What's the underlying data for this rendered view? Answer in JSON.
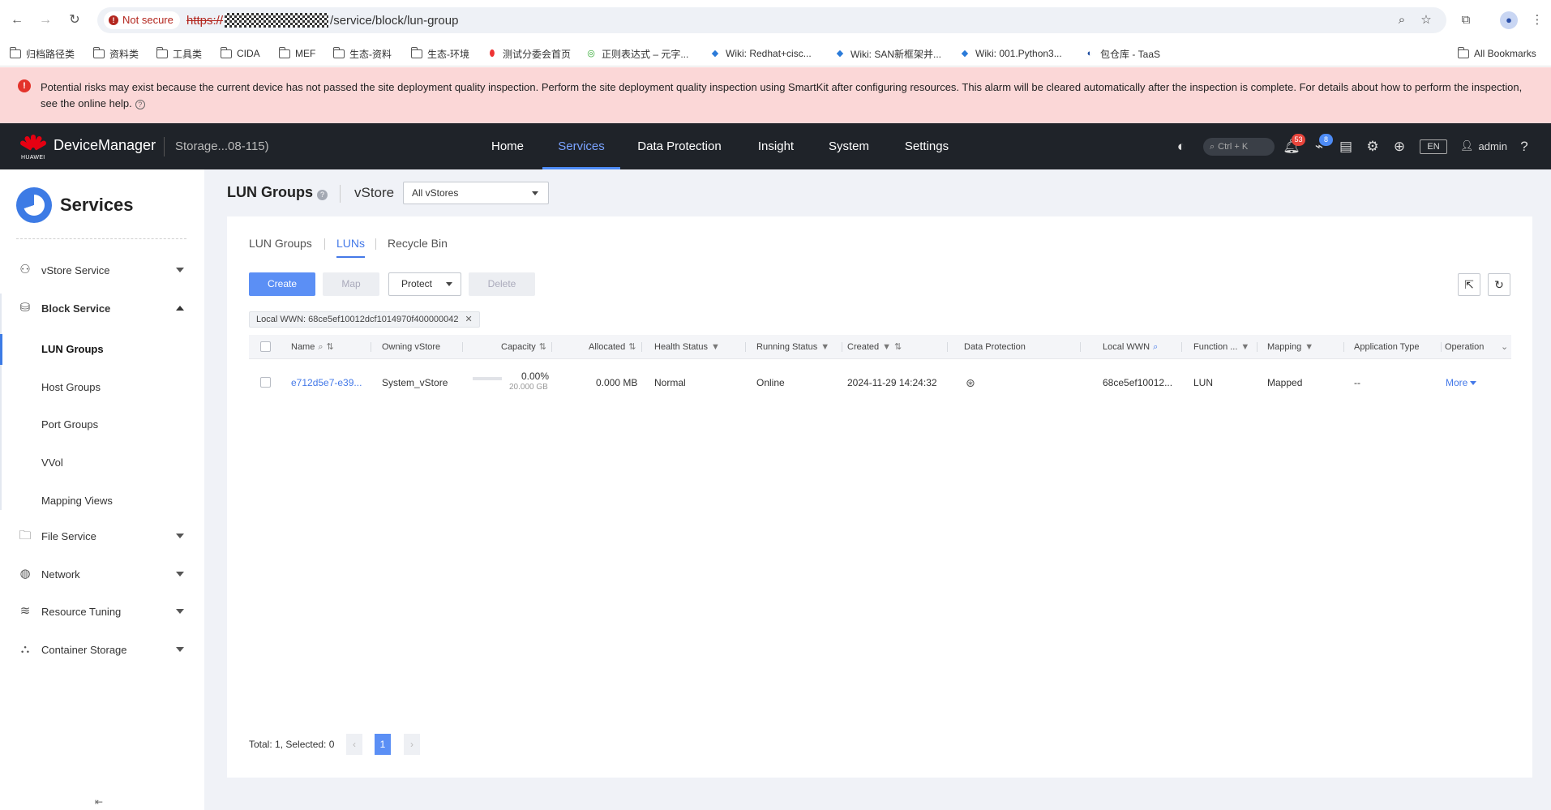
{
  "browser": {
    "not_secure": "Not secure",
    "url_scheme": "https://",
    "url_path": "/service/block/lun-group",
    "bookmarks": [
      "归档路径类",
      "资料类",
      "工具类",
      "CIDA",
      "MEF",
      "生态-资料",
      "生态-环境",
      "测试分委会首页",
      "正则表达式 – 元字...",
      "Wiki: Redhat+cisc...",
      "Wiki: SAN新框架并...",
      "Wiki: 001.Python3...",
      "包仓库 - TaaS"
    ],
    "all_bookmarks": "All Bookmarks"
  },
  "alert": {
    "text": "Potential risks may exist because the current device has not passed the site deployment quality inspection. Perform the site deployment quality inspection using SmartKit after configuring resources. This alarm will be cleared automatically after the inspection is complete. For details about how to perform the inspection, see the online help."
  },
  "header": {
    "logo_word": "HUAWEI",
    "app_name": "DeviceManager",
    "device_name": "Storage...08-115)",
    "nav": [
      "Home",
      "Services",
      "Data Protection",
      "Insight",
      "System",
      "Settings"
    ],
    "active_nav": "Services",
    "search_hint": "Ctrl + K",
    "alarm_count": "53",
    "task_count": "8",
    "language": "EN",
    "user": "admin"
  },
  "sidebar": {
    "title": "Services",
    "items": [
      {
        "label": "vStore Service",
        "icon": "user-group-icon"
      },
      {
        "label": "Block Service",
        "icon": "database-icon"
      },
      {
        "label": "File Service",
        "icon": "folder-icon"
      },
      {
        "label": "Network",
        "icon": "globe-icon"
      },
      {
        "label": "Resource Tuning",
        "icon": "layers-icon"
      },
      {
        "label": "Container Storage",
        "icon": "container-icon"
      }
    ],
    "block_sub": [
      "LUN Groups",
      "Host Groups",
      "Port Groups",
      "VVol",
      "Mapping Views"
    ],
    "active_sub": "LUN Groups"
  },
  "page": {
    "title": "LUN Groups",
    "vstore_label": "vStore",
    "vstore_value": "All vStores",
    "tabs": [
      "LUN Groups",
      "LUNs",
      "Recycle Bin"
    ],
    "active_tab": "LUNs",
    "buttons": {
      "create": "Create",
      "map": "Map",
      "protect": "Protect",
      "delete": "Delete"
    },
    "filter_tag": "Local WWN: 68ce5ef10012dcf1014970f400000042",
    "columns": [
      "Name",
      "Owning vStore",
      "Capacity",
      "Allocated",
      "Health Status",
      "Running Status",
      "Created",
      "Data Protection",
      "Local WWN",
      "Function ...",
      "Mapping",
      "Application Type",
      "Operation"
    ],
    "rows": [
      {
        "name": "e712d5e7-e39...",
        "owning_vstore": "System_vStore",
        "capacity_pct": "0.00%",
        "capacity_total": "20.000 GB",
        "allocated": "0.000 MB",
        "health": "Normal",
        "running": "Online",
        "created": "2024-11-29 14:24:32",
        "local_wwn": "68ce5ef10012...",
        "function": "LUN",
        "mapping": "Mapped",
        "app_type": "--",
        "operation": "More"
      }
    ],
    "pager": {
      "summary": "Total: 1, Selected: 0",
      "current": "1"
    }
  },
  "colors": {
    "accent": "#4479e8",
    "primary_button": "#5b8ff5",
    "header_bg": "#1f2329",
    "alert_bg": "#fbd7d7",
    "badge_red": "#e8453c",
    "badge_blue": "#4d8bf5"
  }
}
